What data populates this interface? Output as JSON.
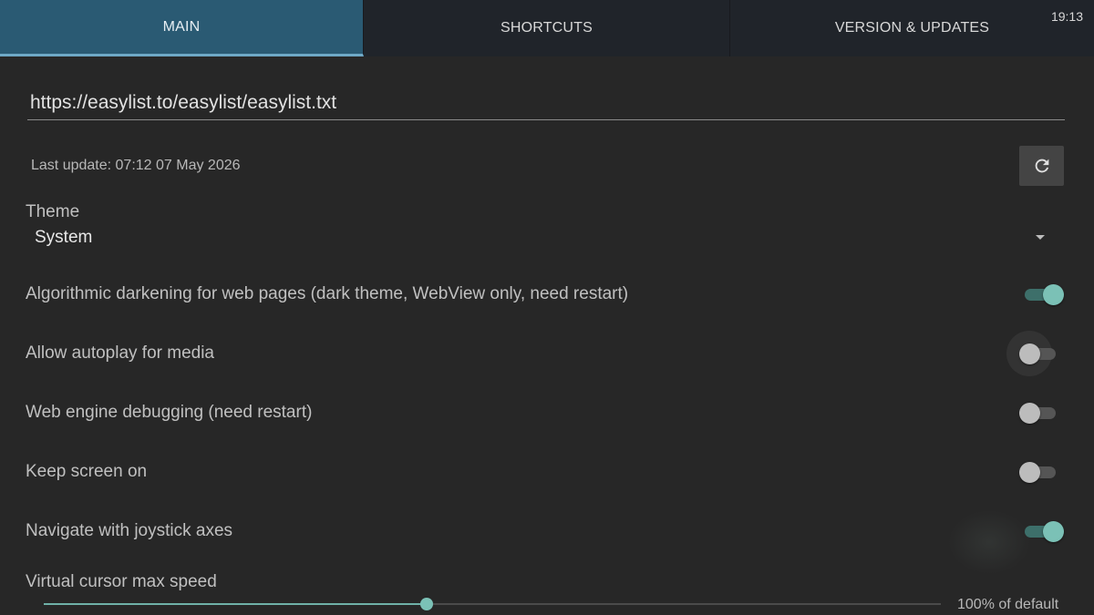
{
  "status_bar": {
    "time": "19:13"
  },
  "tabs": [
    {
      "label": "MAIN",
      "selected": true
    },
    {
      "label": "SHORTCUTS",
      "selected": false
    },
    {
      "label": "VERSION & UPDATES",
      "selected": false
    }
  ],
  "adblock": {
    "url_value": "https://easylist.to/easylist/easylist.txt",
    "last_update": "Last update: 07:12 07 May 2026",
    "refresh_icon": "refresh-icon"
  },
  "theme": {
    "label": "Theme",
    "value": "System",
    "dropdown_icon": "triangle-down-icon"
  },
  "settings": [
    {
      "label": "Algorithmic darkening for web pages (dark theme, WebView only, need restart)",
      "checked": true
    },
    {
      "label": "Allow autoplay for media",
      "checked": false
    },
    {
      "label": "Web engine debugging (need restart)",
      "checked": false
    },
    {
      "label": "Keep screen on",
      "checked": false
    },
    {
      "label": "Navigate with joystick axes",
      "checked": true
    }
  ],
  "cursor_speed": {
    "label": "Virtual cursor max speed",
    "value_text": "100% of default",
    "fraction": 0.427
  },
  "colors": {
    "accent": "#7bc1b6",
    "selected_tab": "#2a5a73",
    "background": "#272727"
  }
}
